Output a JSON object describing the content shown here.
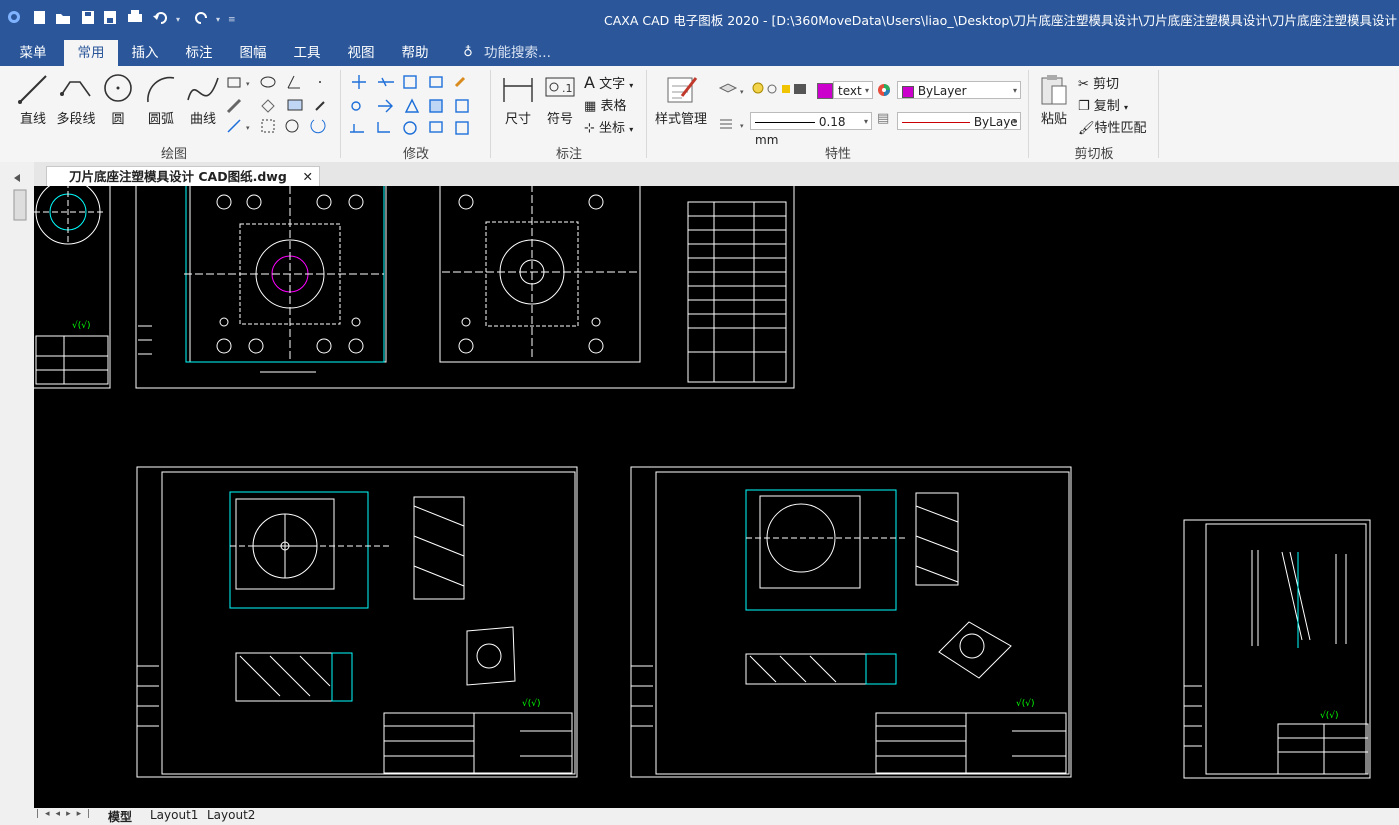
{
  "titlebar": {
    "title": "CAXA CAD 电子图板 2020 - [D:\\360MoveData\\Users\\liao_\\Desktop\\刀片底座注塑模具设计\\刀片底座注塑模具设计\\刀片底座注塑模具设计 CAD图"
  },
  "tabs": [
    "菜单",
    "常用",
    "插入",
    "标注",
    "图幅",
    "工具",
    "视图",
    "帮助"
  ],
  "search_placeholder": "功能搜索...",
  "ribbon": {
    "draw": {
      "group_label": "绘图",
      "line": "直线",
      "polyline": "多段线",
      "circle": "圆",
      "arc": "圆弧",
      "curve": "曲线"
    },
    "modify": {
      "group_label": "修改"
    },
    "annotate": {
      "group_label": "标注",
      "dimension": "尺寸",
      "symbol": "符号",
      "text": "文字",
      "table": "表格",
      "coordinate": "坐标"
    },
    "properties": {
      "group_label": "特性",
      "style_manager": "样式管理",
      "text_style": "text",
      "layer_color": "ByLayer",
      "line_width": "0.18 mm",
      "line_type": "ByLaye"
    },
    "clipboard": {
      "group_label": "剪切板",
      "paste": "粘贴",
      "cut": "剪切",
      "copy": "复制",
      "match_props": "特性匹配"
    }
  },
  "document_tab": "刀片底座注塑模具设计 CAD图纸.dwg",
  "layout_tabs": [
    "模型",
    "Layout1",
    "Layout2"
  ],
  "colors": {
    "ribbon_blue": "#2b579a",
    "canvas": "#000000",
    "magenta_swatch": "#cc00cc",
    "drawing_line": "#ffffff",
    "cyan_dim": "#00ffff",
    "green_dim": "#00ff00"
  }
}
